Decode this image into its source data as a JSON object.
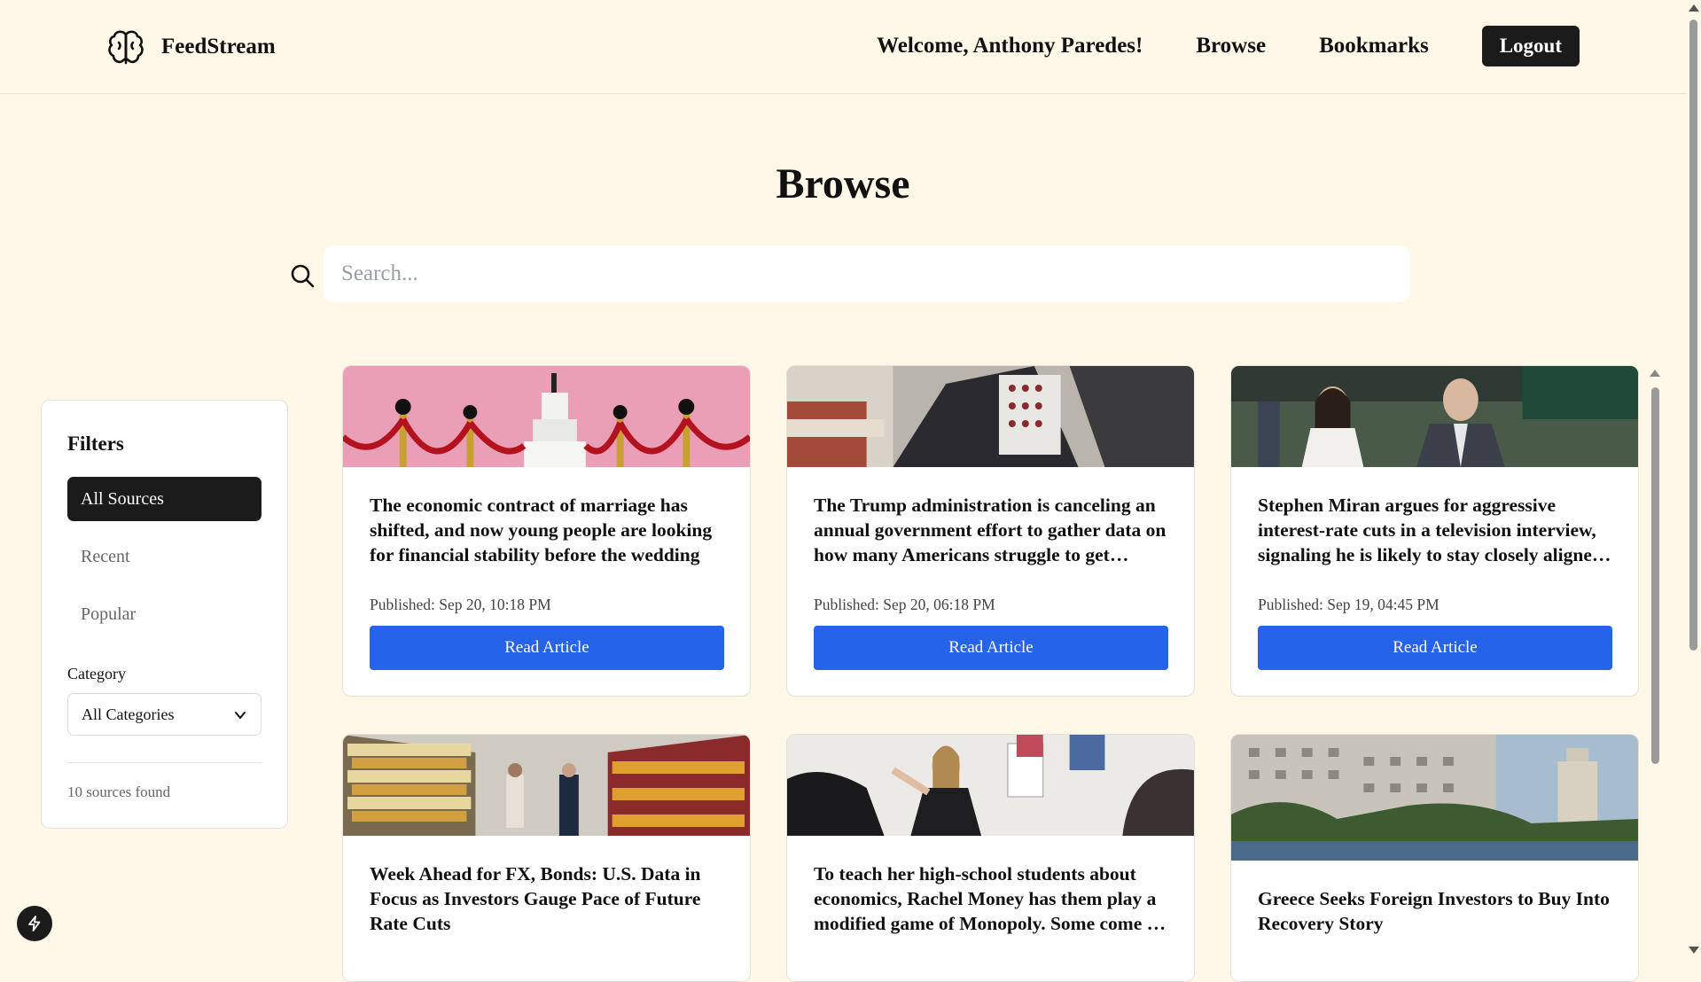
{
  "header": {
    "brand": "FeedStream",
    "welcome": "Welcome, Anthony Paredes!",
    "nav_browse": "Browse",
    "nav_bookmarks": "Bookmarks",
    "logout": "Logout"
  },
  "page": {
    "title": "Browse",
    "search_placeholder": "Search..."
  },
  "filters": {
    "title": "Filters",
    "options": [
      "All Sources",
      "Recent",
      "Popular"
    ],
    "active_option": "All Sources",
    "category_label": "Category",
    "category_selected": "All Categories",
    "sources_found": "10 sources found"
  },
  "articles": [
    {
      "title": "The economic contract of marriage has shifted, and now young people are looking for financial stability before the wedding",
      "published": "Published: Sep 20, 10:18 PM",
      "button": "Read Article",
      "image": "wedding-cake-image"
    },
    {
      "title": "The Trump administration is canceling an annual government effort to gather data on how many Americans struggle to get enough food",
      "published": "Published: Sep 20, 06:18 PM",
      "button": "Read Article",
      "image": "food-bank-image"
    },
    {
      "title": "Stephen Miran argues for aggressive interest-rate cuts in a television interview, signaling he is likely to stay closely aligned with Trump",
      "published": "Published: Sep 19, 04:45 PM",
      "button": "Read Article",
      "image": "officials-walking-image"
    },
    {
      "title": "Week Ahead for FX, Bonds: U.S. Data in Focus as Investors Gauge Pace of Future Rate Cuts",
      "image": "grocery-aisle-image"
    },
    {
      "title": "To teach her high-school students about economics, Rachel Money has them play a modified game of Monopoly. Some come to class with big questions",
      "image": "classroom-teacher-image"
    },
    {
      "title": "Greece Seeks Foreign Investors to Buy Into Recovery Story",
      "image": "thessaloniki-waterfront-image"
    }
  ],
  "colors": {
    "page_background": "#fff8e8",
    "primary_button": "#2563eb",
    "dark": "#1b1b1b"
  },
  "icons": [
    "brain-logo-icon",
    "search-icon",
    "chevron-down-icon",
    "lightning-icon"
  ]
}
